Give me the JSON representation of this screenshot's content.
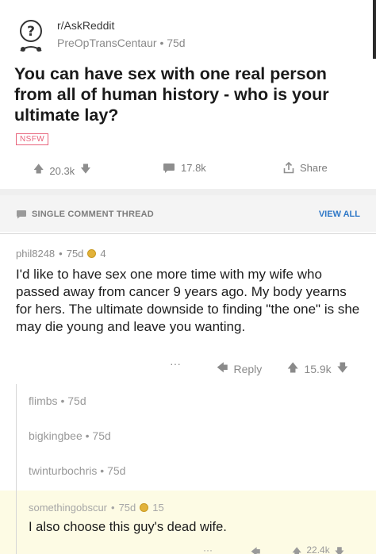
{
  "post": {
    "subreddit": "r/AskReddit",
    "author": "PreOpTransCentaur",
    "age": "75d",
    "title": "You can have sex with one real person from all of human history - who is your ultimate lay?",
    "badge": "NSFW",
    "score": "20.3k",
    "comments": "17.8k",
    "share_label": "Share"
  },
  "thread": {
    "label": "SINGLE COMMENT THREAD",
    "view_all": "VIEW ALL"
  },
  "comment": {
    "author": "phil8248",
    "age": "75d",
    "awards": "4",
    "body": "I'd like to have sex one more time with my wife who passed away from cancer 9 years ago. My body yearns for hers. The ultimate downside to finding \"the one\" is she may die young and leave you wanting.",
    "more": "···",
    "reply_label": "Reply",
    "score": "15.9k"
  },
  "children": [
    {
      "author": "flimbs",
      "age": "75d"
    },
    {
      "author": "bigkingbee",
      "age": "75d"
    },
    {
      "author": "twinturbochris",
      "age": "75d"
    }
  ],
  "highlight": {
    "author": "somethingobscur",
    "age": "75d",
    "awards": "15",
    "body": "I also choose this guy's dead wife.",
    "more": "···",
    "score": "22.4k"
  },
  "colors": {
    "nsfw": "#e8647c",
    "link": "#2f78c7",
    "gold": "#e2b23a",
    "highlight_bg": "#fdfbe4"
  }
}
